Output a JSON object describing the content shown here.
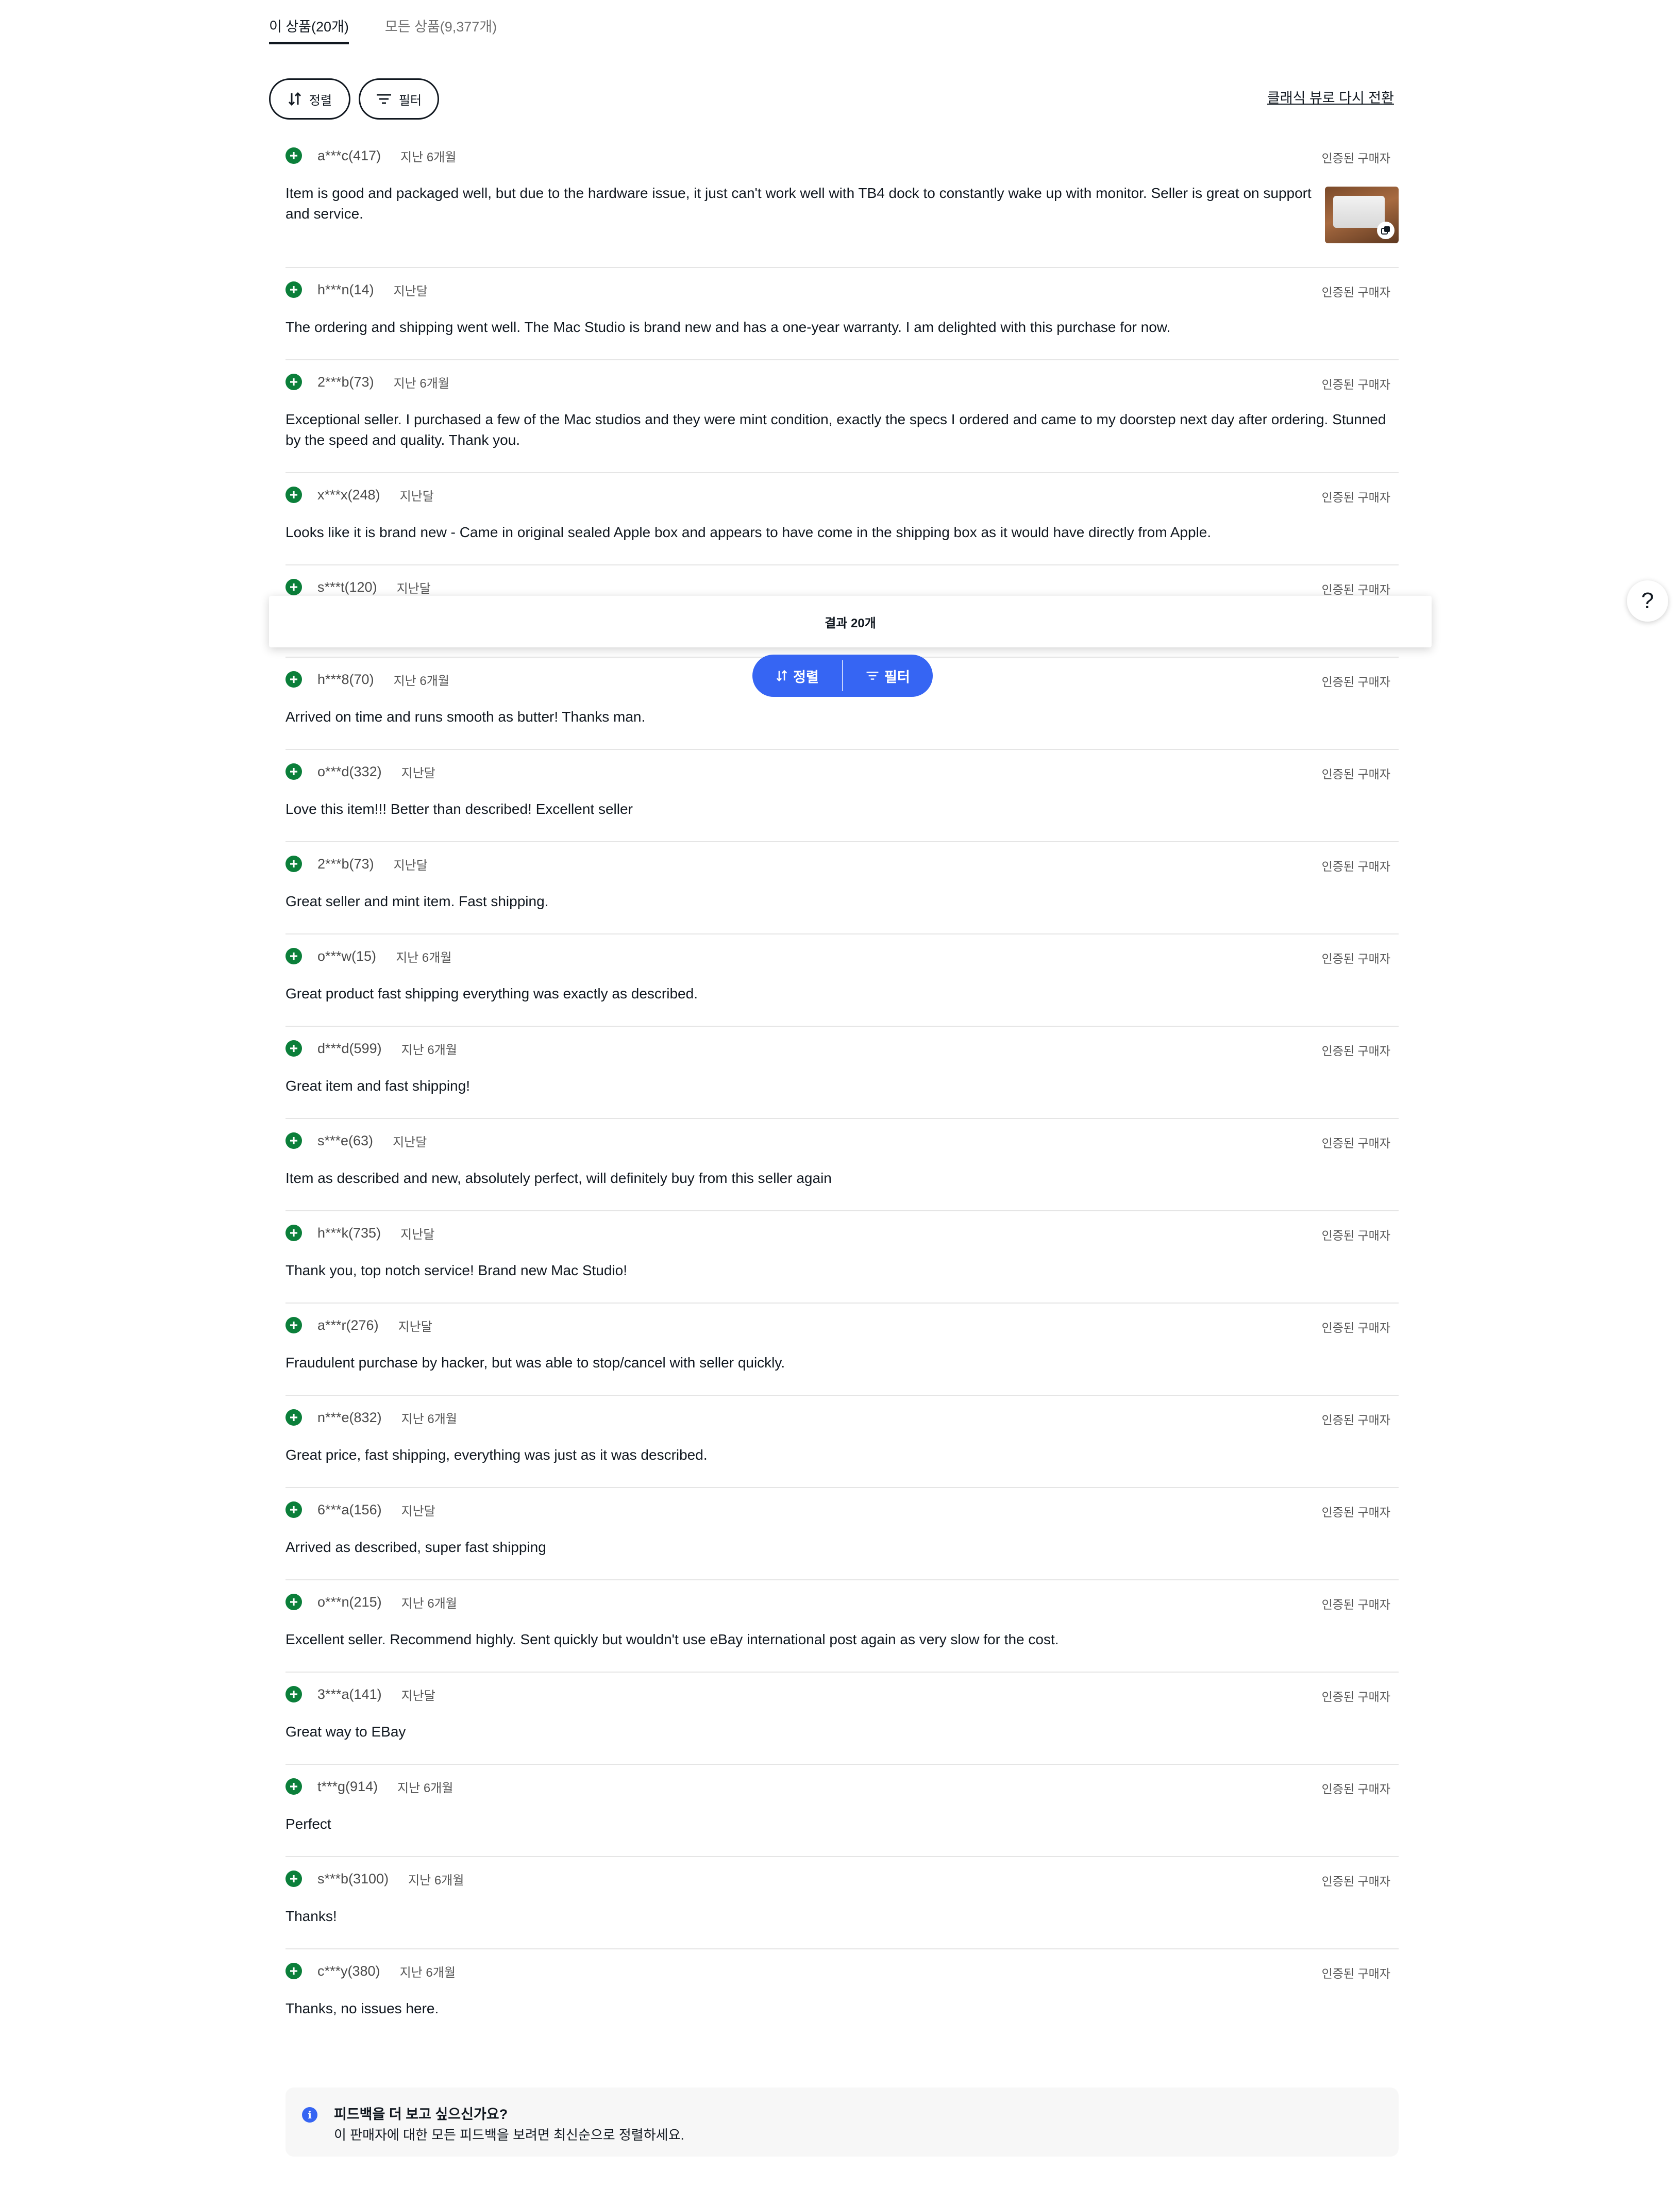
{
  "tabs": [
    {
      "label": "이 상품(20개)",
      "active": true
    },
    {
      "label": "모든 상품(9,377개)",
      "active": false
    }
  ],
  "toolbar": {
    "sort_label": "정렬",
    "filter_label": "필터",
    "classic_view_link": "클래식 뷰로 다시 전환"
  },
  "reviews": [
    {
      "user": "a***c(417)",
      "time": "지난 6개월",
      "verified": "인증된 구매자",
      "text": "Item is good and packaged well, but due to the hardware issue, it just can't work well with TB4 dock to constantly wake up with monitor. Seller is great on support and service.",
      "has_photo": true
    },
    {
      "user": "h***n(14)",
      "time": "지난달",
      "verified": "인증된 구매자",
      "text": "The ordering and shipping went well. The Mac Studio is brand new and has a one-year warranty. I am delighted with this purchase for now."
    },
    {
      "user": "2***b(73)",
      "time": "지난 6개월",
      "verified": "인증된 구매자",
      "text": "Exceptional seller. I purchased a few of the Mac studios and they were mint condition, exactly the specs I ordered and came to my doorstep next day after ordering. Stunned by the speed and quality. Thank you."
    },
    {
      "user": "x***x(248)",
      "time": "지난달",
      "verified": "인증된 구매자",
      "text": "Looks like it is brand new - Came in original sealed Apple box and appears to have come in the shipping box as it would have directly from Apple."
    },
    {
      "user": "s***t(120)",
      "time": "지난달",
      "verified": "인증된 구매자",
      "text": ""
    },
    {
      "user": "h***8(70)",
      "time": "지난 6개월",
      "verified": "인증된 구매자",
      "text": "Arrived on time and runs smooth as butter! Thanks man."
    },
    {
      "user": "o***d(332)",
      "time": "지난달",
      "verified": "인증된 구매자",
      "text": "Love this item!!! Better than described! Excellent seller"
    },
    {
      "user": "2***b(73)",
      "time": "지난달",
      "verified": "인증된 구매자",
      "text": "Great seller and mint item. Fast shipping."
    },
    {
      "user": "o***w(15)",
      "time": "지난 6개월",
      "verified": "인증된 구매자",
      "text": "Great product fast shipping everything was exactly as described."
    },
    {
      "user": "d***d(599)",
      "time": "지난 6개월",
      "verified": "인증된 구매자",
      "text": "Great item and fast shipping!"
    },
    {
      "user": "s***e(63)",
      "time": "지난달",
      "verified": "인증된 구매자",
      "text": "Item as described and new, absolutely perfect, will definitely buy from this seller again"
    },
    {
      "user": "h***k(735)",
      "time": "지난달",
      "verified": "인증된 구매자",
      "text": "Thank you, top notch service! Brand new Mac Studio!"
    },
    {
      "user": "a***r(276)",
      "time": "지난달",
      "verified": "인증된 구매자",
      "text": "Fraudulent purchase by hacker, but was able to stop/cancel with seller quickly."
    },
    {
      "user": "n***e(832)",
      "time": "지난 6개월",
      "verified": "인증된 구매자",
      "text": "Great price, fast shipping, everything was just as it was described."
    },
    {
      "user": "6***a(156)",
      "time": "지난달",
      "verified": "인증된 구매자",
      "text": "Arrived as described, super fast shipping"
    },
    {
      "user": "o***n(215)",
      "time": "지난 6개월",
      "verified": "인증된 구매자",
      "text": "Excellent seller. Recommend highly. Sent quickly but wouldn't use eBay international post again as very slow for the cost."
    },
    {
      "user": "3***a(141)",
      "time": "지난달",
      "verified": "인증된 구매자",
      "text": "Great way to EBay"
    },
    {
      "user": "t***g(914)",
      "time": "지난 6개월",
      "verified": "인증된 구매자",
      "text": "Perfect"
    },
    {
      "user": "s***b(3100)",
      "time": "지난 6개월",
      "verified": "인증된 구매자",
      "text": "Thanks!"
    },
    {
      "user": "c***y(380)",
      "time": "지난 6개월",
      "verified": "인증된 구매자",
      "text": "Thanks, no issues here."
    }
  ],
  "results_bar": {
    "label": "결과 20개"
  },
  "floating_pill": {
    "sort_label": "정렬",
    "filter_label": "필터"
  },
  "help_button": {
    "label": "?"
  },
  "info_box": {
    "icon": "i",
    "title": "피드백을 더 보고 싶으신가요?",
    "subtitle": "이 판매자에 대한 모든 피드백을 보려면 최신순으로 정렬하세요."
  },
  "colors": {
    "positive_icon": "#0b7f3a",
    "accent_blue": "#3665f3",
    "text": "#111820",
    "divider": "#e5e5e5"
  },
  "icons": {
    "positive": "plus-circle-icon",
    "sort": "sort-arrows-icon",
    "filter": "filter-lines-icon",
    "photo_badge": "multi-photo-icon",
    "info": "info-icon"
  }
}
